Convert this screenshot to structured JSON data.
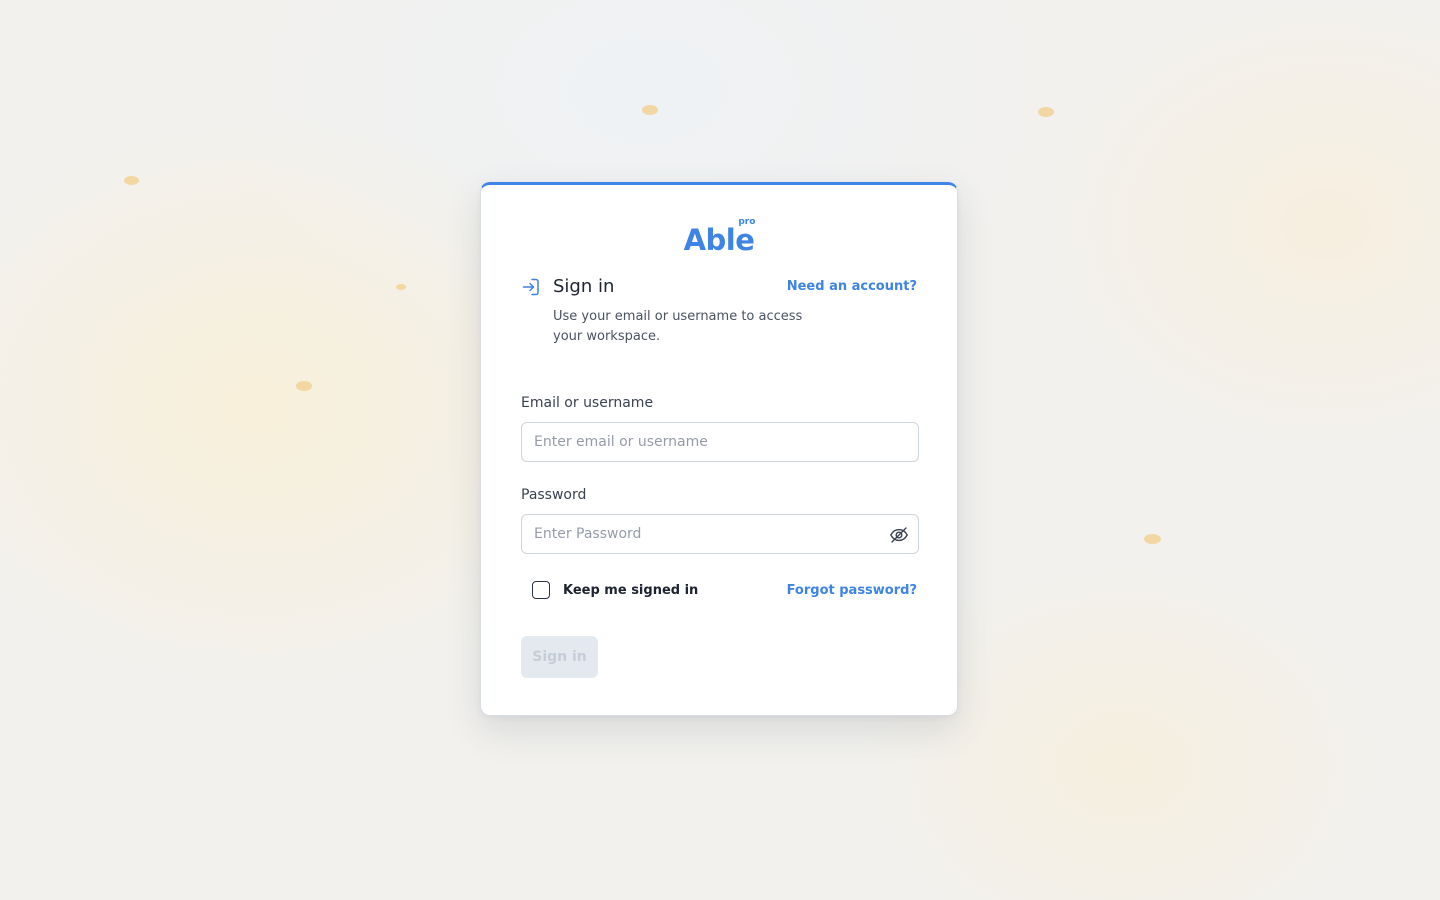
{
  "brand": {
    "name": "Able",
    "superscript": "pro",
    "accent_color": "#3d84e4"
  },
  "header": {
    "icon": "login-arrow-icon",
    "title": "Sign in",
    "subtitle": "Use your email or username to access your workspace.",
    "need_account_link": "Need an account?"
  },
  "form": {
    "email": {
      "label": "Email or username",
      "placeholder": "Enter email or username",
      "value": ""
    },
    "password": {
      "label": "Password",
      "placeholder": "Enter Password",
      "value": "",
      "toggle_icon": "eye-off-icon"
    },
    "remember": {
      "label": "Keep me signed in",
      "checked": false
    },
    "forgot_link": "Forgot password?",
    "submit_label": "Sign in",
    "submit_disabled": true
  }
}
